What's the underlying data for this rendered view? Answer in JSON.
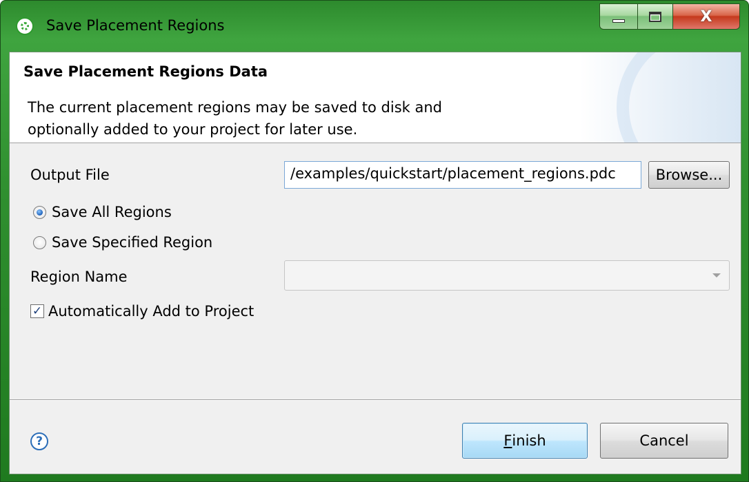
{
  "window": {
    "title": "Save Placement Regions",
    "accent_color": "#2f8f2f"
  },
  "banner": {
    "title": "Save Placement Regions Data",
    "description": "The current placement regions may be saved to disk and optionally added to your project for later use."
  },
  "form": {
    "output_file_label": "Output File",
    "output_file_value": "/examples/quickstart/placement_regions.pdc",
    "browse_label": "Browse...",
    "radio_all_label": "Save All Regions",
    "radio_all_selected": true,
    "radio_specified_label": "Save Specified Region",
    "radio_specified_selected": false,
    "region_name_label": "Region Name",
    "region_name_value": "",
    "auto_add_label": "Automatically Add to Project",
    "auto_add_checked": true
  },
  "footer": {
    "help_icon": "question-circle-icon",
    "finish_label_accel": "F",
    "finish_label_rest": "inish",
    "cancel_label": "Cancel"
  }
}
